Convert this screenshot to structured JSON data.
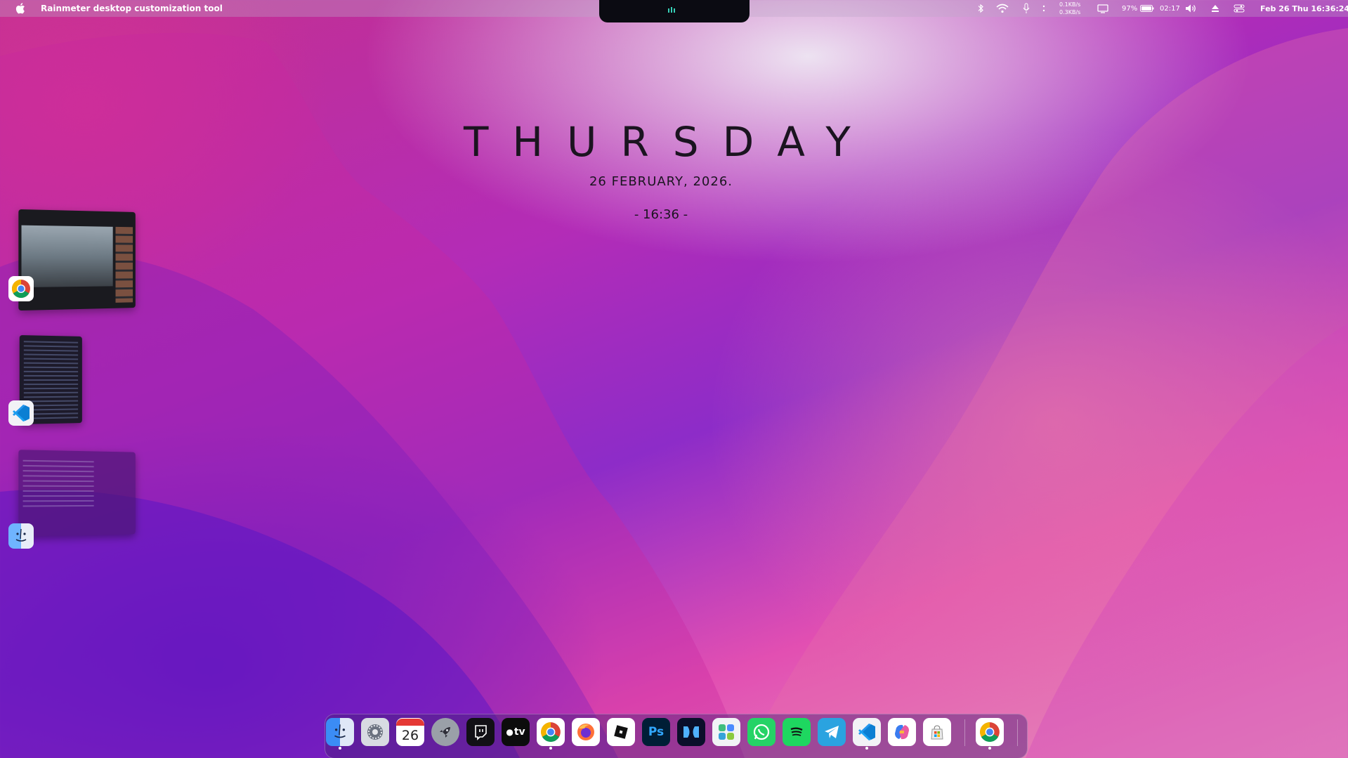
{
  "menubar": {
    "app_title": "Rainmeter desktop customization tool",
    "net_up": "0.1KB/s",
    "net_down": "0.3KB/s",
    "battery_percent": "97%",
    "battery_time": "02:17",
    "datetime": "Feb 26 Thu 16:36:24",
    "icons": [
      "apple-icon",
      "bluetooth-icon",
      "wifi-icon",
      "microphone-icon",
      "more-icon",
      "display-icon",
      "battery-icon",
      "volume-icon",
      "eject-icon",
      "control-center-icon"
    ]
  },
  "widget": {
    "day": "THURSDAY",
    "date": "26  FEBRUARY,  2026.",
    "time": "- 16:36 -"
  },
  "stage_manager": {
    "windows": [
      {
        "app": "Chrome",
        "icon": "chrome-icon"
      },
      {
        "app": "Visual Studio Code",
        "icon": "vscode-icon"
      },
      {
        "app": "Finder",
        "icon": "finder-icon"
      }
    ]
  },
  "dock": {
    "items": [
      {
        "name": "Finder",
        "icon": "finder-icon",
        "running": true
      },
      {
        "name": "Settings",
        "icon": "settings-icon",
        "running": false
      },
      {
        "name": "Calendar",
        "icon": "calendar-icon",
        "label": "26",
        "running": false
      },
      {
        "name": "Launchpad",
        "icon": "rocket-icon",
        "running": false
      },
      {
        "name": "Twitch",
        "icon": "twitch-icon",
        "running": false
      },
      {
        "name": "Apple TV",
        "icon": "appletv-icon",
        "label": "tv",
        "running": false
      },
      {
        "name": "Chrome",
        "icon": "chrome-icon",
        "running": true
      },
      {
        "name": "Firefox",
        "icon": "firefox-icon",
        "running": false
      },
      {
        "name": "Roblox",
        "icon": "roblox-icon",
        "running": false
      },
      {
        "name": "Photoshop",
        "icon": "photoshop-icon",
        "label": "Ps",
        "running": false
      },
      {
        "name": "Dolby",
        "icon": "dolby-icon",
        "running": false
      },
      {
        "name": "Mosaic",
        "icon": "mosaic-icon",
        "running": false
      },
      {
        "name": "WhatsApp",
        "icon": "whatsapp-icon",
        "running": false
      },
      {
        "name": "Spotify",
        "icon": "spotify-icon",
        "running": false
      },
      {
        "name": "Telegram",
        "icon": "telegram-icon",
        "running": false
      },
      {
        "name": "VS Code",
        "icon": "vscode-icon",
        "running": true
      },
      {
        "name": "Copilot",
        "icon": "copilot-icon",
        "running": false
      },
      {
        "name": "Store",
        "icon": "store-icon",
        "running": false
      },
      {
        "name": "Chrome",
        "icon": "chrome-icon",
        "running": true
      }
    ]
  }
}
